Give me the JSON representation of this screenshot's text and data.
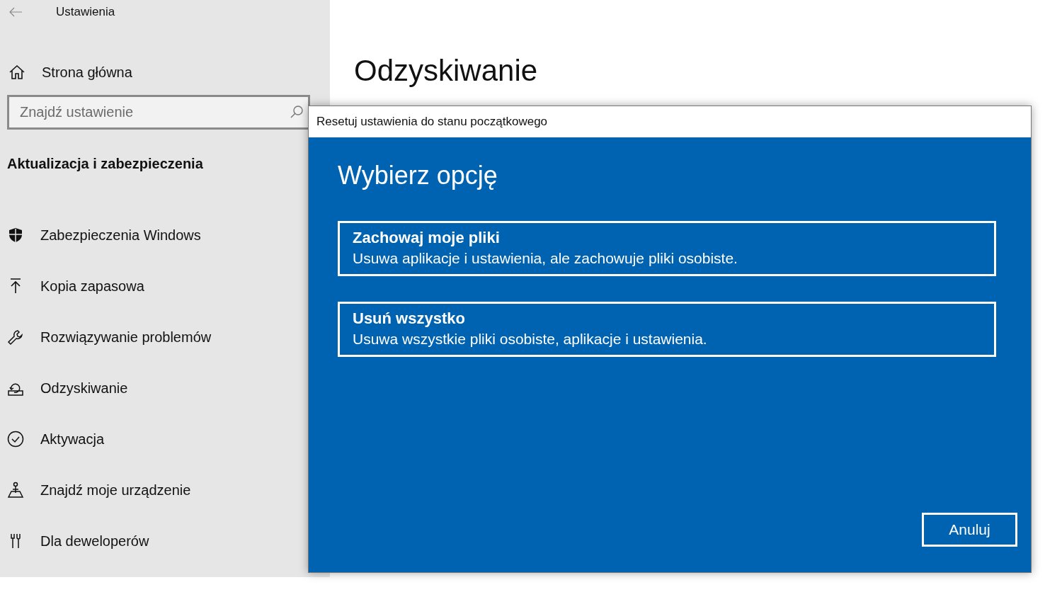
{
  "window": {
    "title": "Ustawienia"
  },
  "sidebar": {
    "home": "Strona główna",
    "search": {
      "placeholder": "Znajdź ustawienie"
    },
    "section": "Aktualizacja i zabezpieczenia",
    "items": [
      {
        "kind": "shield",
        "label": "Zabezpieczenia Windows"
      },
      {
        "kind": "backup",
        "label": "Kopia zapasowa"
      },
      {
        "kind": "wrench",
        "label": "Rozwiązywanie problemów"
      },
      {
        "kind": "recovery",
        "label": "Odzyskiwanie"
      },
      {
        "kind": "activation",
        "label": "Aktywacja"
      },
      {
        "kind": "find",
        "label": "Znajdź moje urządzenie"
      },
      {
        "kind": "developer",
        "label": "Dla deweloperów"
      }
    ]
  },
  "main": {
    "title": "Odzyskiwanie"
  },
  "dialog": {
    "title": "Resetuj ustawienia do stanu początkowego",
    "heading": "Wybierz opcję",
    "options": [
      {
        "title": "Zachowaj moje pliki",
        "description": "Usuwa aplikacje i ustawienia, ale zachowuje pliki osobiste."
      },
      {
        "title": "Usuń wszystko",
        "description": "Usuwa wszystkie pliki osobiste, aplikacje i ustawienia."
      }
    ],
    "cancel": "Anuluj"
  }
}
